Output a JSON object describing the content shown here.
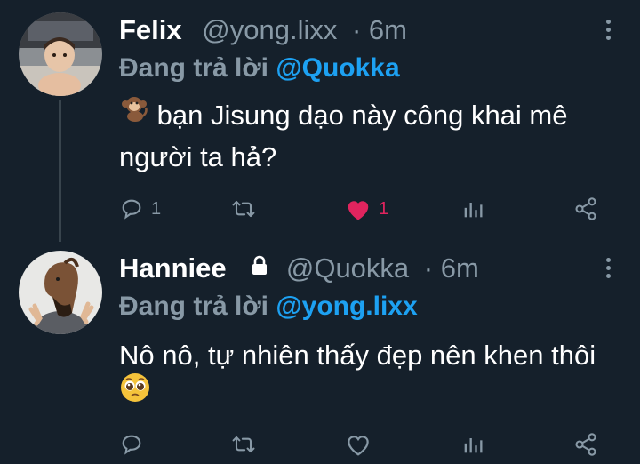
{
  "tweets": [
    {
      "name": "Felix",
      "handle": "@yong.lixx",
      "time": "· 6m",
      "replying_prefix": "Đang trả lời",
      "replying_to": "@Quokka",
      "text_emoji": "monkey-emoji",
      "text": "bạn Jisung dạo này công khai mê người ta hả?",
      "reply_count": "1",
      "retweet_count": "",
      "like_count": "1",
      "liked": true,
      "protected": false
    },
    {
      "name": "Hanniee",
      "handle": "@Quokka",
      "time": "· 6m",
      "replying_prefix": "Đang trả lời",
      "replying_to": "@yong.lixx",
      "text": "Nô nô, tự nhiên thấy đẹp nên khen thôi",
      "text_trailing_emoji": "pleading-face-emoji",
      "reply_count": "",
      "retweet_count": "",
      "like_count": "",
      "liked": false,
      "protected": true
    }
  ],
  "colors": {
    "background": "#15202b",
    "secondary_text": "#8899a6",
    "mention": "#1da1f2",
    "like": "#e0245e",
    "thread_line": "#38444d"
  }
}
